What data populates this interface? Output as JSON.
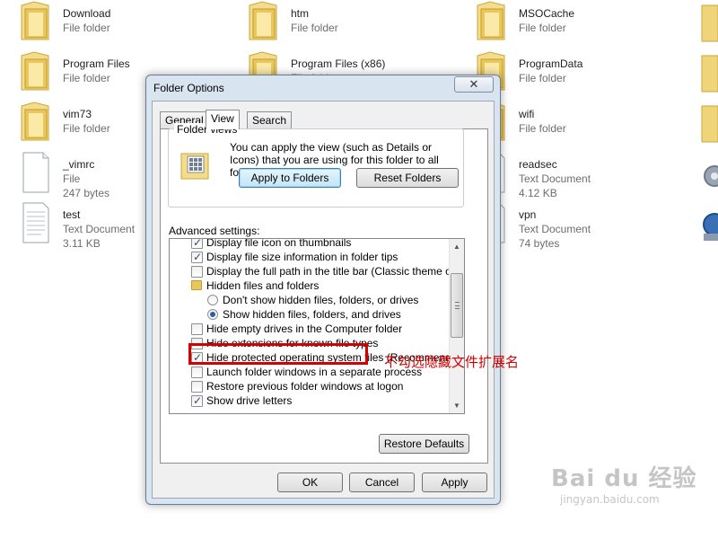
{
  "files": [
    {
      "name": "Download",
      "type": "File folder",
      "size": "",
      "icon": "folder-icon"
    },
    {
      "name": "htm",
      "type": "File folder",
      "size": "",
      "icon": "folder-icon"
    },
    {
      "name": "MSOCache",
      "type": "File folder",
      "size": "",
      "icon": "folder-icon"
    },
    {
      "name": "Program Files",
      "type": "File folder",
      "size": "",
      "icon": "folder-icon"
    },
    {
      "name": "Program Files (x86)",
      "type": "File folder",
      "size": "",
      "icon": "folder-icon"
    },
    {
      "name": "ProgramData",
      "type": "File folder",
      "size": "",
      "icon": "folder-icon"
    },
    {
      "name": "vim73",
      "type": "File folder",
      "size": "",
      "icon": "folder-icon"
    },
    {
      "name": "wifi",
      "type": "File folder",
      "size": "",
      "icon": "folder-icon"
    },
    {
      "name": "_vimrc",
      "type": "File",
      "size": "247 bytes",
      "icon": "file-icon"
    },
    {
      "name": "readsec",
      "type": "Text Document",
      "size": "4.12 KB",
      "icon": "text-document-icon"
    },
    {
      "name": "test",
      "type": "Text Document",
      "size": "3.11 KB",
      "icon": "text-document-icon"
    },
    {
      "name": "vpn",
      "type": "Text Document",
      "size": "74 bytes",
      "icon": "text-document-icon"
    }
  ],
  "dialog": {
    "title": "Folder Options",
    "close_label": "✕",
    "tabs": [
      {
        "label": "General",
        "active": false
      },
      {
        "label": "View",
        "active": true
      },
      {
        "label": "Search",
        "active": false
      }
    ],
    "folder_views": {
      "label": "Folder views",
      "description": "You can apply the view (such as Details or Icons) that you are using for this folder to all folders of this type.",
      "apply_button": "Apply to Folders",
      "reset_button": "Reset Folders"
    },
    "advanced_label": "Advanced settings:",
    "advanced_items": [
      {
        "kind": "checkbox",
        "checked": true,
        "label": "Display file icon on thumbnails"
      },
      {
        "kind": "checkbox",
        "checked": true,
        "label": "Display file size information in folder tips"
      },
      {
        "kind": "checkbox",
        "checked": false,
        "label": "Display the full path in the title bar (Classic theme only)"
      },
      {
        "kind": "folder",
        "label": "Hidden files and folders"
      },
      {
        "kind": "radio",
        "checked": false,
        "label": "Don't show hidden files, folders, or drives"
      },
      {
        "kind": "radio",
        "checked": true,
        "label": "Show hidden files, folders, and drives"
      },
      {
        "kind": "checkbox",
        "checked": false,
        "label": "Hide empty drives in the Computer folder"
      },
      {
        "kind": "checkbox",
        "checked": false,
        "label": "Hide extensions for known file types"
      },
      {
        "kind": "checkbox",
        "checked": true,
        "label": "Hide protected operating system files (Recommended)"
      },
      {
        "kind": "checkbox",
        "checked": false,
        "label": "Launch folder windows in a separate process"
      },
      {
        "kind": "checkbox",
        "checked": false,
        "label": "Restore previous folder windows at logon"
      },
      {
        "kind": "checkbox",
        "checked": true,
        "label": "Show drive letters"
      }
    ],
    "restore_defaults": "Restore Defaults",
    "ok": "OK",
    "cancel": "Cancel",
    "apply": "Apply"
  },
  "annotation": "不勾选隐藏文件扩展名",
  "watermark": {
    "main": "Bai du 经验",
    "sub": "jingyan.baidu.com"
  },
  "colors": {
    "annotation": "#d40000",
    "folder": "#e8c75c",
    "focus_button": "#c4e5f6"
  }
}
